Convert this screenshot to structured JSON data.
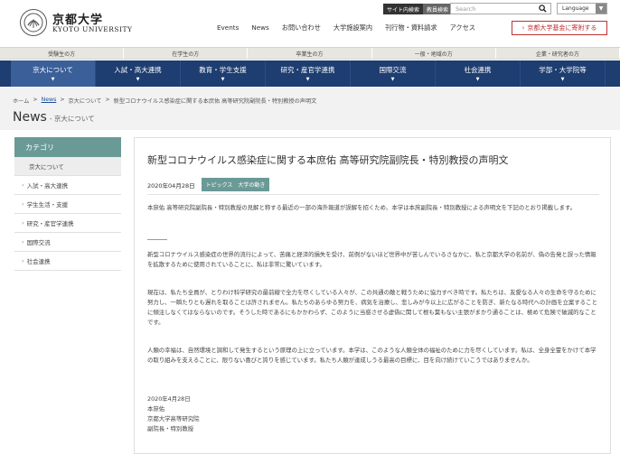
{
  "header": {
    "logo_ja": "京都大学",
    "logo_en": "KYOTO UNIVERSITY",
    "util_tabs": [
      "サイト内検索",
      "教員検索"
    ],
    "search_placeholder": "Search",
    "language_label": "Language",
    "gnav": [
      "Events",
      "News",
      "お問い合わせ",
      "大学施設案内",
      "刊行物・資料請求",
      "アクセス"
    ],
    "donate_label": "京都大学基金に寄附する"
  },
  "audience_nav": [
    "受験生の方",
    "在学生の方",
    "卒業生の方",
    "一般・地域の方",
    "企業・研究者の方"
  ],
  "main_nav": [
    {
      "label": "京大について",
      "active": true
    },
    {
      "label": "入試・高大連携",
      "active": false
    },
    {
      "label": "教育・学生支援",
      "active": false
    },
    {
      "label": "研究・産官学連携",
      "active": false
    },
    {
      "label": "国際交流",
      "active": false
    },
    {
      "label": "社会連携",
      "active": false
    },
    {
      "label": "学部・大学院等",
      "active": false
    }
  ],
  "breadcrumb": [
    "ホーム",
    "News",
    "京大について",
    "新型コロナウイルス感染症に関する本庶佑 高等研究院副院長・特別教授の声明文"
  ],
  "page_title": "News",
  "page_subtitle": "- 京大について",
  "sidebar": {
    "heading": "カテゴリ",
    "items": [
      {
        "label": "京大について",
        "active": true
      },
      {
        "label": "入試・高大連携",
        "active": false
      },
      {
        "label": "学生生活・支援",
        "active": false
      },
      {
        "label": "研究・産官学連携",
        "active": false
      },
      {
        "label": "国際交流",
        "active": false
      },
      {
        "label": "社会連携",
        "active": false
      }
    ]
  },
  "article": {
    "title": "新型コロナウイルス感染症に関する本庶佑 高等研究院副院長・特別教授の声明文",
    "date": "2020年04月28日",
    "tag": "トピックス　大学の動き",
    "intro": "本庶佑 高等研究院副院長・特別教授の見解と称する最近の一部の海外報道が誤解を招くため、本学は本庶副院長・特別教授による声明文を下記のとおり掲載します。",
    "p1": "新型コロナウイルス感染症の世界的流行によって、苦痛と経済的損失を受け、前例がないほど世界中が苦しんでいるさなかに、私と京都大学の名前が、偽の告発と誤った情報を拡散するために使用されていることに、私は非常に驚いています。",
    "p2": "現在は、私たち全員が、とりわけ科学研究の最前線で全力を尽くしている人々が、この共通の敵と戦うために協力すべき時です。私たちは、友愛なる人々の生命を守るために努力し、一瞬たりとも遅れを取ることは許されません。私たちのあらゆる努力を、病気を治療し、悲しみが今以上に広がることを防ぎ、新たなる時代への計画を立案することに傾注しなくてはならないのです。そうした時であるにもかかわらず、このように当惑させる虚偽に関して根も葉もない主張がまかり通ることは、極めて危険で破滅的なことです。",
    "p3": "人類の幸福は、自然環境と調和して発生するという原理の上に立っています。本学は、このような人類全体の福祉のために力を尽くしています。私は、全身全霊をかけて本学の取り組みを支えることに、限りない喜びと誇りを感じています。私たち人類が達成しうる最高の目標に、目を向け続けていこうではありませんか。",
    "sign": [
      "2020年4月28日",
      "本庶佑",
      "京都大学高等研究院",
      "副院長・特別教授"
    ]
  }
}
